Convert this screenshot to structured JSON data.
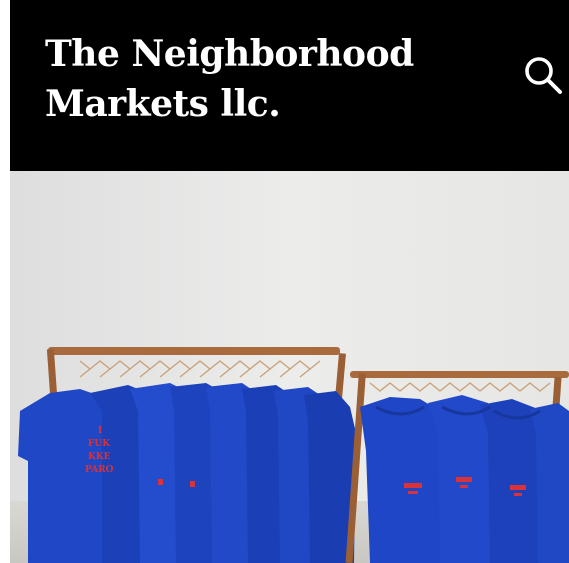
{
  "header": {
    "title_line1": "The Neighborhood",
    "title_line2": "Markets llc.",
    "search_icon": "search-icon"
  },
  "hero": {
    "shirt_print_lines": [
      "I",
      "FUK",
      "KKE",
      "PARO"
    ],
    "colors": {
      "header_bg": "#000000",
      "title": "#ffffff",
      "garment_blue": "#1f47c8",
      "print_red": "#d8323a",
      "rack_wood": "#a96b3e",
      "wall": "#ebebea"
    }
  }
}
